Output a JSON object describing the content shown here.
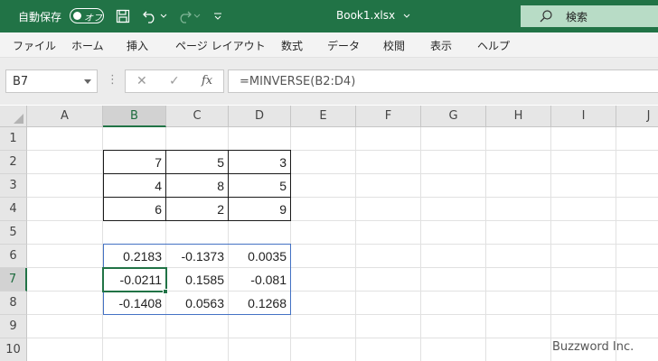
{
  "titlebar": {
    "autosave_label": "自動保存",
    "autosave_state": "オフ",
    "file_title": "Book1.xlsx",
    "search_label": "検索",
    "accent_color": "#217346"
  },
  "menu": [
    "ファイル",
    "ホーム",
    "挿入",
    "ページ レイアウト",
    "数式",
    "データ",
    "校閲",
    "表示",
    "ヘルプ"
  ],
  "formula_bar": {
    "name_box": "B7",
    "fx_label": "fx",
    "formula": "=MINVERSE(B2:D4)"
  },
  "sheet": {
    "columns": [
      "A",
      "B",
      "C",
      "D",
      "E",
      "F",
      "G",
      "H",
      "I",
      "J"
    ],
    "rows": [
      "1",
      "2",
      "3",
      "4",
      "5",
      "6",
      "7",
      "8",
      "9",
      "10"
    ],
    "selected_column": "B",
    "selected_row": "7",
    "matrix": [
      [
        "7",
        "5",
        "3"
      ],
      [
        "4",
        "8",
        "5"
      ],
      [
        "6",
        "2",
        "9"
      ]
    ],
    "inverse": [
      [
        "0.2183",
        "-0.1373",
        "0.0035"
      ],
      [
        "-0.0211",
        "0.1585",
        "-0.081"
      ],
      [
        "-0.1408",
        "0.0563",
        "0.1268"
      ]
    ]
  },
  "watermark": "Buzzword Inc."
}
